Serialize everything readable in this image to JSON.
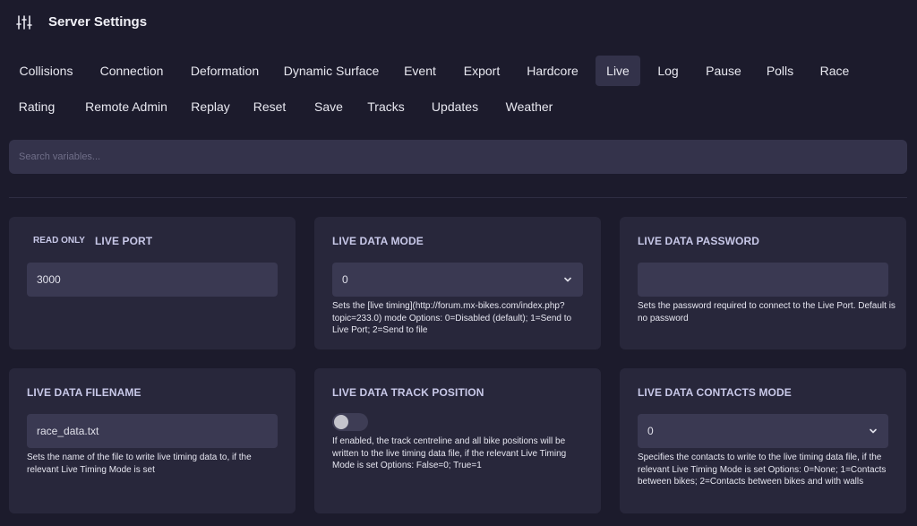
{
  "header": {
    "title": "Server Settings",
    "icon": "sliders-icon"
  },
  "tabs": [
    {
      "label": "Collisions"
    },
    {
      "label": "Connection"
    },
    {
      "label": "Deformation"
    },
    {
      "label": "Dynamic Surface"
    },
    {
      "label": "Event"
    },
    {
      "label": "Export"
    },
    {
      "label": "Hardcore"
    },
    {
      "label": "Live"
    },
    {
      "label": "Log"
    },
    {
      "label": "Pause"
    },
    {
      "label": "Polls"
    },
    {
      "label": "Race"
    },
    {
      "label": "Rating"
    },
    {
      "label": "Remote Admin"
    },
    {
      "label": "Replay"
    },
    {
      "label": "Reset"
    },
    {
      "label": "Save"
    },
    {
      "label": "Tracks"
    },
    {
      "label": "Updates"
    },
    {
      "label": "Weather"
    }
  ],
  "active_tab": "Live",
  "search": {
    "placeholder": "Search variables..."
  },
  "cards": {
    "live_port": {
      "badge": "READ ONLY",
      "label": "LIVE PORT",
      "value": "3000"
    },
    "live_data_mode": {
      "label": "LIVE DATA MODE",
      "value": "0",
      "description": "Sets the [live timing](http://forum.mx-bikes.com/index.php?topic=233.0) mode Options: 0=Disabled (default); 1=Send to Live Port; 2=Send to file"
    },
    "live_data_password": {
      "label": "LIVE DATA PASSWORD",
      "value": "",
      "description": "Sets the password required to connect to the Live Port. Default is no password"
    },
    "live_data_filename": {
      "label": "LIVE DATA FILENAME",
      "value": "race_data.txt",
      "description": "Sets the name of the file to write live timing data to, if the relevant Live Timing Mode is set"
    },
    "live_data_track_position": {
      "label": "LIVE DATA TRACK POSITION",
      "enabled": false,
      "description": "If enabled, the track centreline and all bike positions will be written to the live timing data file, if the relevant Live Timing Mode is set Options: False=0; True=1"
    },
    "live_data_contacts_mode": {
      "label": "LIVE DATA CONTACTS MODE",
      "value": "0",
      "description": "Specifies the contacts to write to the live timing data file, if the relevant Live Timing Mode is set Options: 0=None; 1=Contacts between bikes; 2=Contacts between bikes and with walls"
    }
  },
  "colors": {
    "background": "#1c1b2c",
    "card": "#28273b",
    "input": "#3a3952",
    "label": "#c8c8e8"
  }
}
